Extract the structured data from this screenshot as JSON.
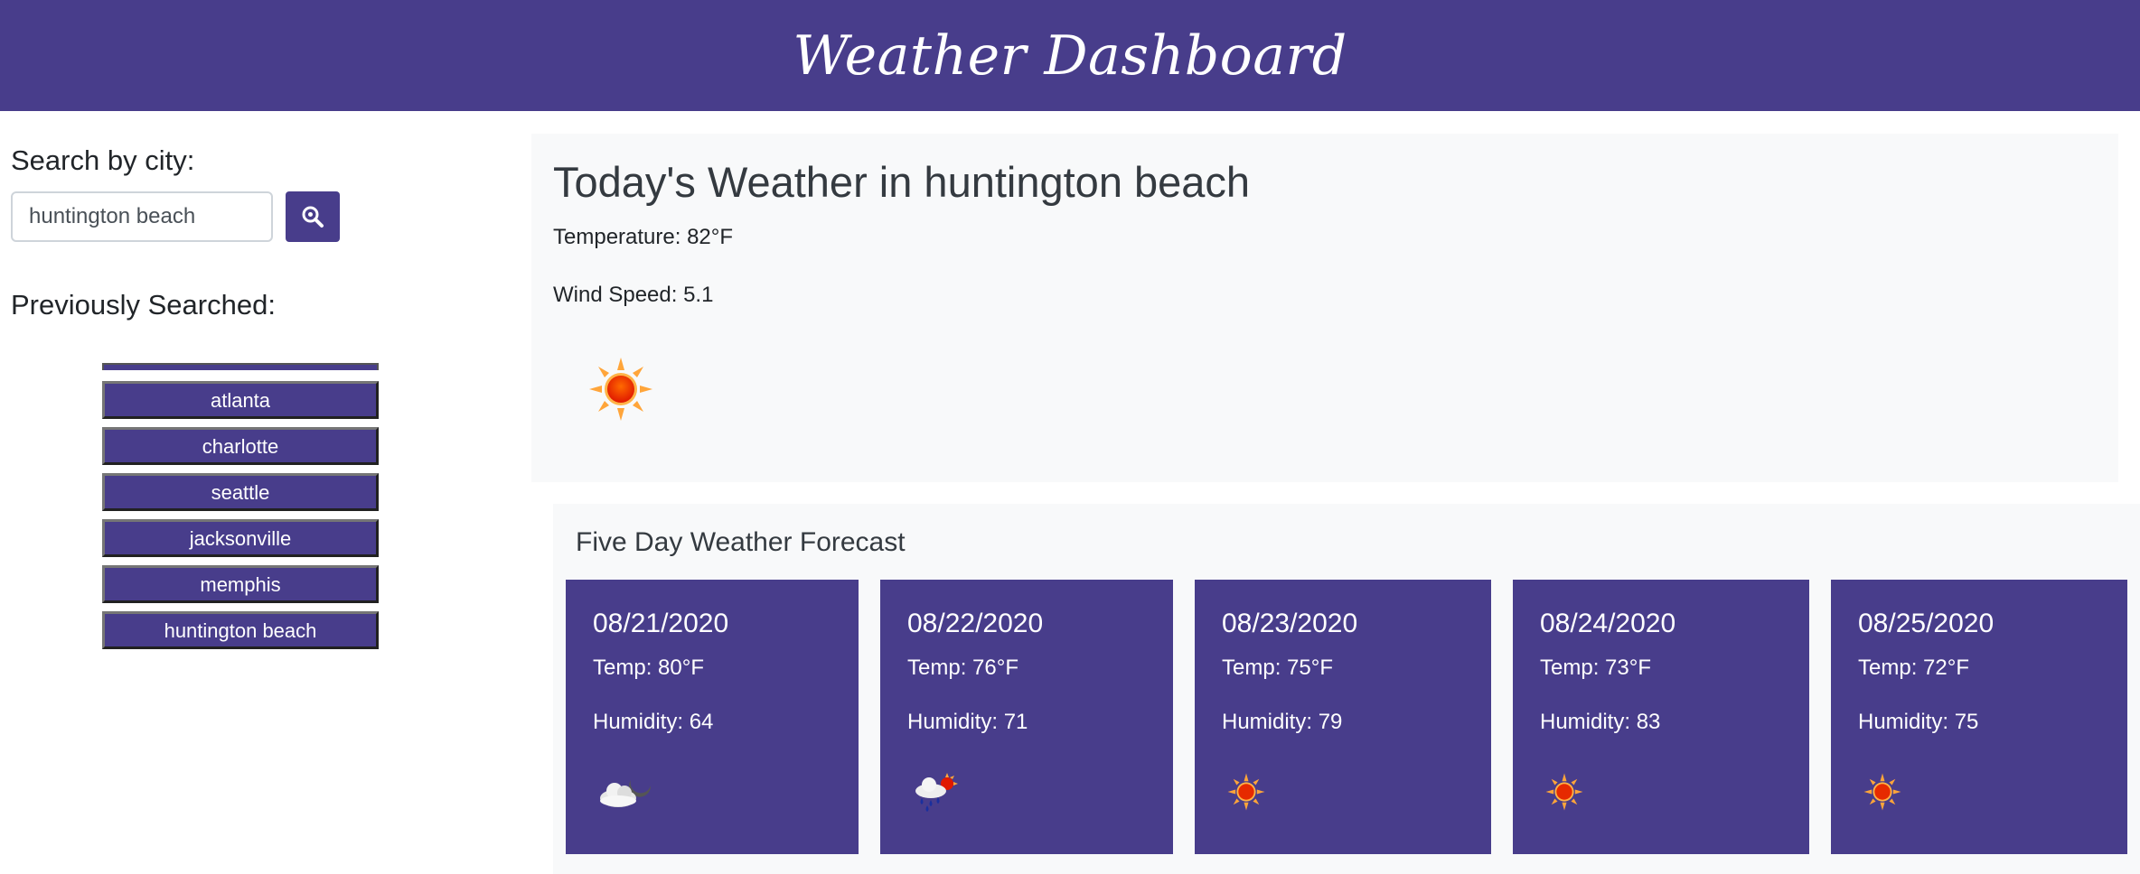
{
  "header": {
    "title": "Weather Dashboard"
  },
  "search": {
    "label": "Search by city:",
    "value": "huntington beach"
  },
  "history": {
    "title": "Previously Searched:",
    "items": [
      "atlanta",
      "charlotte",
      "seattle",
      "jacksonville",
      "memphis",
      "huntington beach"
    ]
  },
  "today": {
    "title": "Today's Weather in huntington beach",
    "temperature": "Temperature: 82°F",
    "wind": "Wind Speed: 5.1",
    "icon": "sun-icon"
  },
  "forecast": {
    "title": "Five Day Weather Forecast",
    "days": [
      {
        "date": "08/21/2020",
        "temp": "Temp: 80°F",
        "humidity": "Humidity: 64",
        "icon": "partly-cloudy-night-icon"
      },
      {
        "date": "08/22/2020",
        "temp": "Temp: 76°F",
        "humidity": "Humidity: 71",
        "icon": "rain-sun-icon"
      },
      {
        "date": "08/23/2020",
        "temp": "Temp: 75°F",
        "humidity": "Humidity: 79",
        "icon": "sun-icon"
      },
      {
        "date": "08/24/2020",
        "temp": "Temp: 73°F",
        "humidity": "Humidity: 83",
        "icon": "sun-icon"
      },
      {
        "date": "08/25/2020",
        "temp": "Temp: 72°F",
        "humidity": "Humidity: 75",
        "icon": "sun-icon"
      }
    ]
  },
  "colors": {
    "brand": "#483d8b",
    "panel": "#f8f9fa"
  }
}
